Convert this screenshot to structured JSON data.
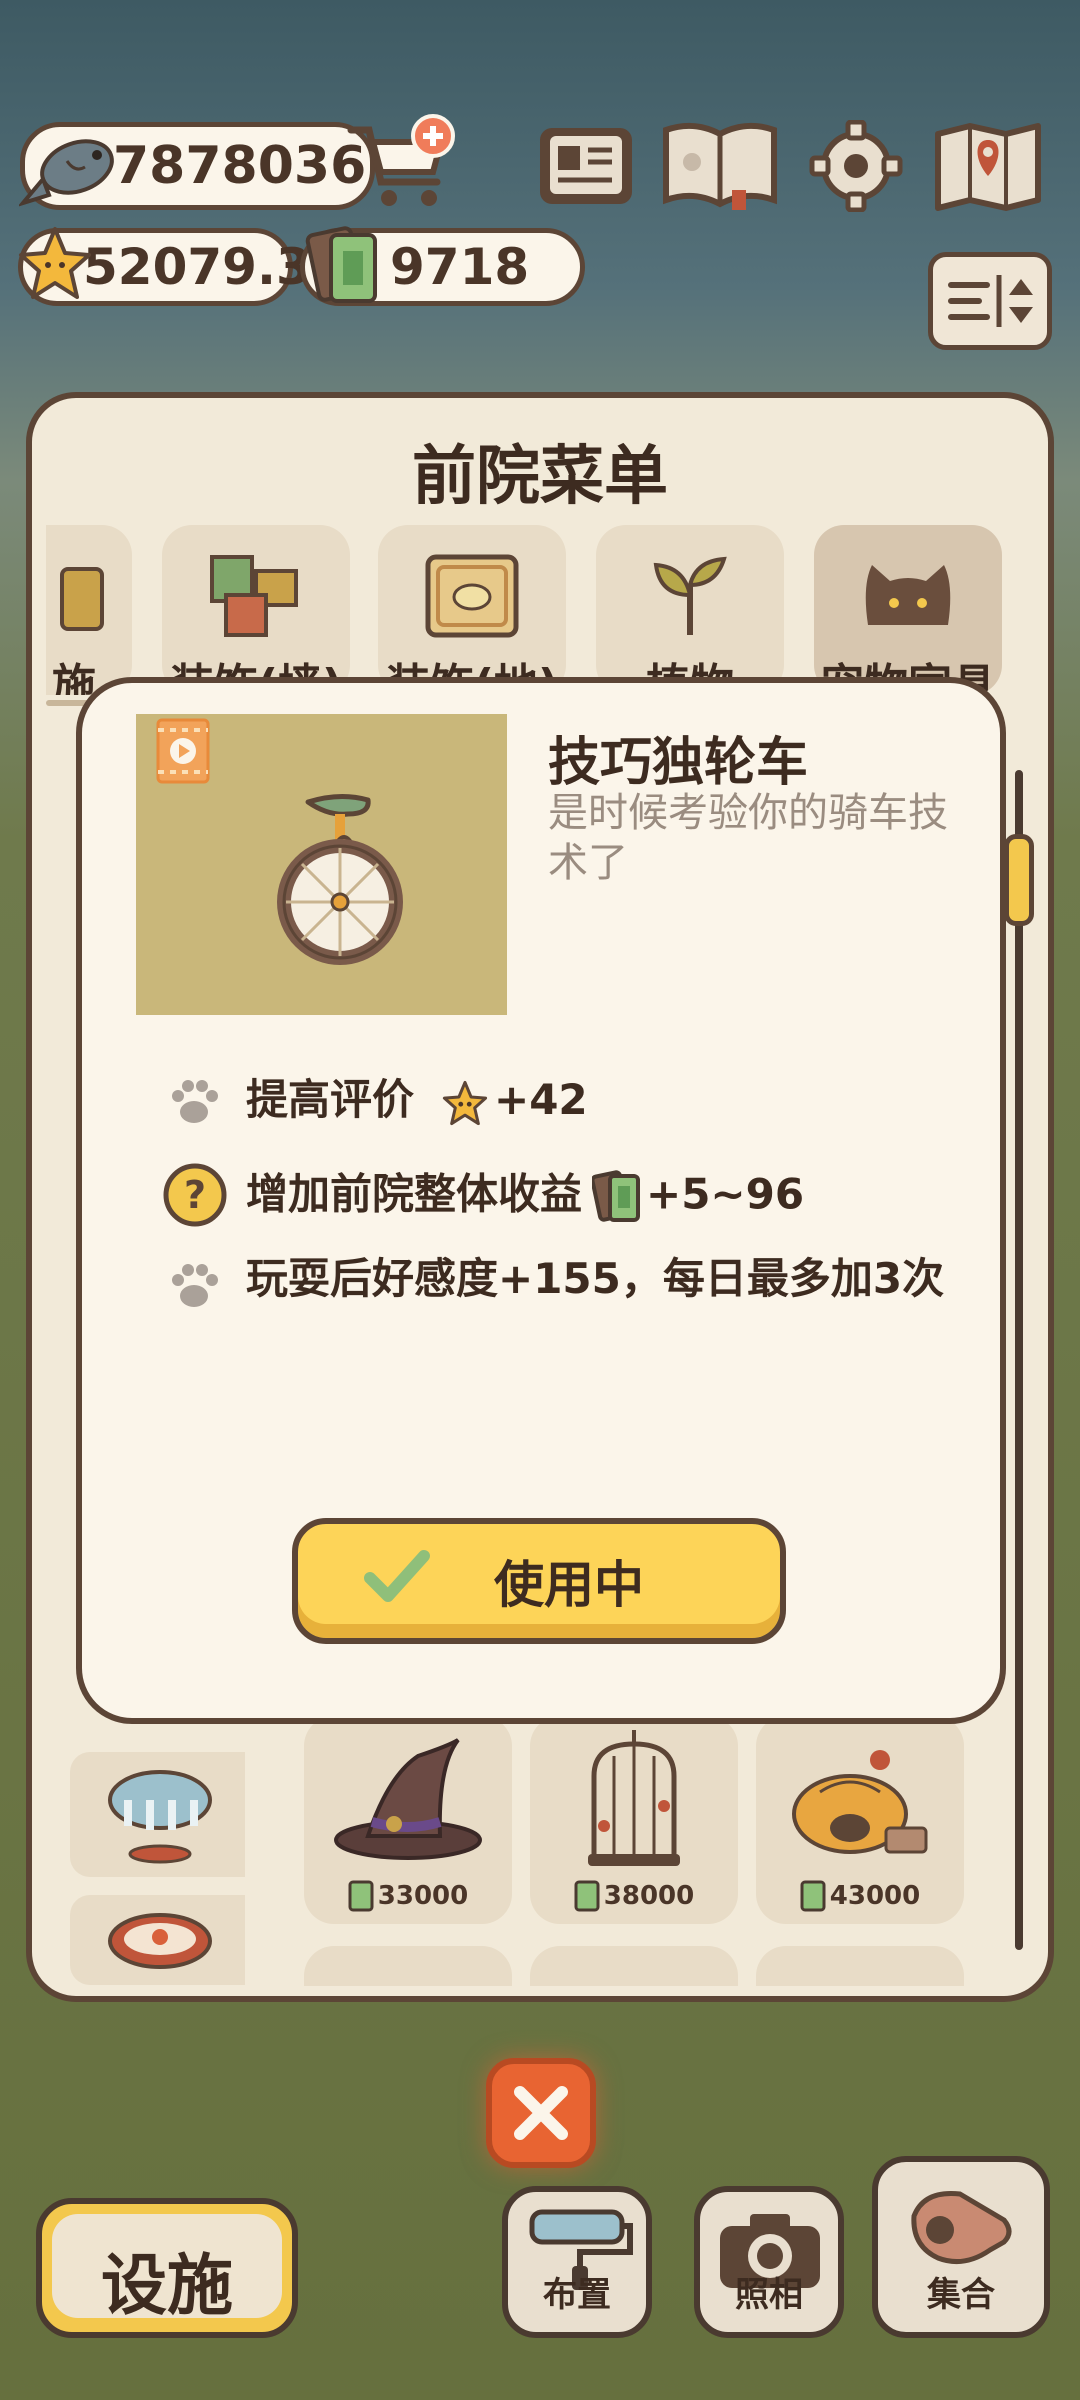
{
  "hud": {
    "fish_count": "7878036",
    "star_count": "52079.3",
    "ticket_count": "9718"
  },
  "panel": {
    "title": "前院菜单",
    "tabs": [
      {
        "label": "施",
        "icon": "facility-icon"
      },
      {
        "label": "装饰(墙)",
        "icon": "wall-decor-icon"
      },
      {
        "label": "装饰(地)",
        "icon": "floor-decor-icon"
      },
      {
        "label": "植物",
        "icon": "plant-icon"
      },
      {
        "label": "宠物家具",
        "icon": "cat-face-icon",
        "active": true
      }
    ],
    "shop_items": [
      {
        "name": "witch-hat",
        "price": "33000"
      },
      {
        "name": "bird-cage",
        "price": "38000"
      },
      {
        "name": "pumpkin-house",
        "price": "43000"
      }
    ]
  },
  "dialog": {
    "title": "技巧独轮车",
    "description": "是时候考验你的骑车技术了",
    "stats": {
      "rating_label": "提高评价",
      "rating_value": "+42",
      "income_label": "增加前院整体收益",
      "income_value": "+5~96",
      "affection_text": "玩耍后好感度+155，每日最多加3次"
    },
    "use_button": "使用中"
  },
  "bottom": {
    "facility": "设施",
    "layout": "布置",
    "photo": "照相",
    "gather": "集合"
  },
  "colors": {
    "outline": "#5c4536",
    "panel_bg": "#f2ead9",
    "button_yellow": "#fdd458",
    "close_orange": "#e86432"
  }
}
